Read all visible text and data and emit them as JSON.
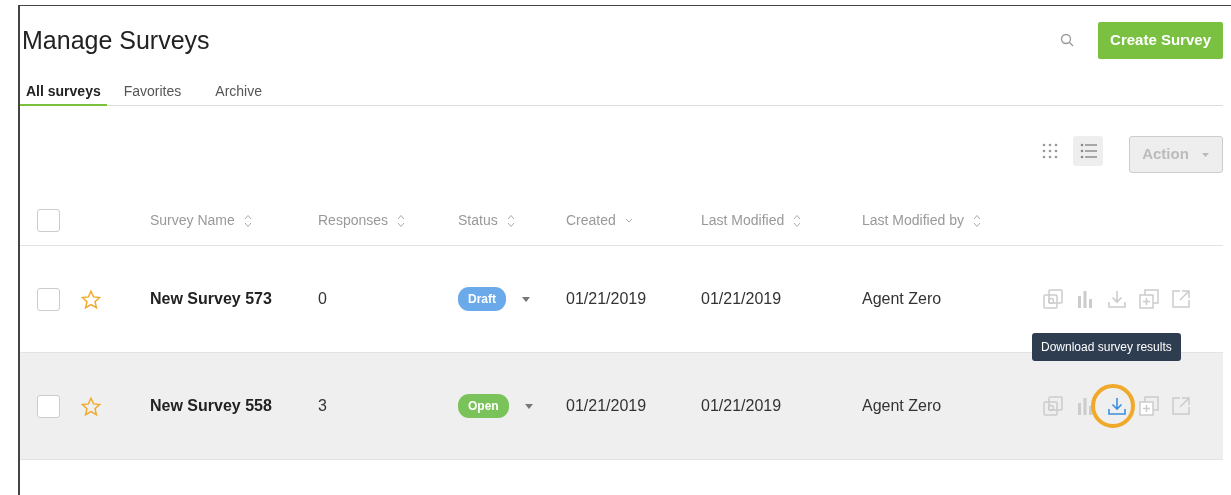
{
  "header": {
    "title": "Manage Surveys",
    "create_button": "Create Survey"
  },
  "tabs": [
    {
      "label": "All surveys",
      "selected": true
    },
    {
      "label": "Favorites",
      "selected": false
    },
    {
      "label": "Archive",
      "selected": false
    }
  ],
  "view_toggle": [
    {
      "kind": "grid",
      "selected": false
    },
    {
      "kind": "list",
      "selected": true
    }
  ],
  "action_button": {
    "label": "Action",
    "disabled": true
  },
  "table": {
    "select_all": {
      "checked": false
    },
    "columns": [
      {
        "label": "Survey Name",
        "sorted": false
      },
      {
        "label": "Responses",
        "sorted": false
      },
      {
        "label": "Status",
        "sorted": false
      },
      {
        "label": "Created",
        "sorted": true
      },
      {
        "label": "Last Modified",
        "sorted": false
      },
      {
        "label": "Last Modified by",
        "sorted": false
      }
    ],
    "rows": [
      {
        "checked": false,
        "favorite": false,
        "hovered": false,
        "name": "New Survey 573",
        "responses": "0",
        "status": {
          "label": "Draft",
          "kind": "draft"
        },
        "created": "01/21/2019",
        "modified": "01/21/2019",
        "modified_by": "Agent Zero",
        "actions": [
          {
            "kind": "copy",
            "active": false
          },
          {
            "kind": "chart",
            "active": false
          },
          {
            "kind": "download",
            "active": false
          },
          {
            "kind": "add",
            "active": false
          },
          {
            "kind": "open",
            "active": false
          }
        ]
      },
      {
        "checked": false,
        "favorite": false,
        "hovered": true,
        "name": "New Survey 558",
        "responses": "3",
        "status": {
          "label": "Open",
          "kind": "open"
        },
        "created": "01/21/2019",
        "modified": "01/21/2019",
        "modified_by": "Agent Zero",
        "actions": [
          {
            "kind": "copy",
            "active": false
          },
          {
            "kind": "chart",
            "active": false
          },
          {
            "kind": "download",
            "active": true,
            "tooltip": "Download survey results"
          },
          {
            "kind": "add",
            "active": false
          },
          {
            "kind": "open",
            "active": false
          }
        ]
      }
    ]
  }
}
